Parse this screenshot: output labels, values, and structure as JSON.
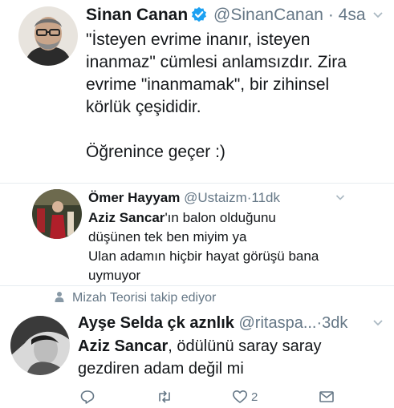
{
  "main_tweet": {
    "name": "Sinan Canan",
    "handle": "@SinanCanan",
    "dot": "·",
    "time": "4sa",
    "text_p1": "\"İsteyen evrime inanır, isteyen\ninanmaz\" cümlesi anlamsızdır. Zira\nevrime \"inanmamak\", bir zihinsel\nkörlük çeşididir.",
    "text_p2": "Öğrenince geçer :)"
  },
  "quoted_tweet": {
    "name": "Ömer Hayyam",
    "handle": "@Ustaizm",
    "dot": "·",
    "time": "11dk",
    "mention": "Aziz Sancar",
    "text_after_mention": "'ın balon olduğunu",
    "line2": "düşünen tek ben miyim ya",
    "line3": "Ulan adamın hiçbir hayat görüşü bana",
    "line4": "uymuyor"
  },
  "context": {
    "text": "Mizah Teorisi takip ediyor"
  },
  "reply_tweet": {
    "name": "Ayşe Selda çk aznlık",
    "handle": "@ritaspa...",
    "dot": "·",
    "time": "3dk",
    "mention": "Aziz Sancar",
    "text_after_mention": ", ödülünü saray saray",
    "line2": "gezdiren adam değil mi"
  },
  "actions": {
    "like_count": "2"
  },
  "icons": {
    "verified": "verified-badge-icon",
    "chevron": "chevron-down-icon",
    "reply": "reply-icon",
    "retweet": "retweet-icon",
    "like": "heart-icon",
    "dm": "envelope-icon",
    "person": "person-icon"
  },
  "colors": {
    "verified_blue": "#1da1f2",
    "text": "#14171a",
    "secondary": "#657786",
    "divider": "#e6ecf0"
  }
}
